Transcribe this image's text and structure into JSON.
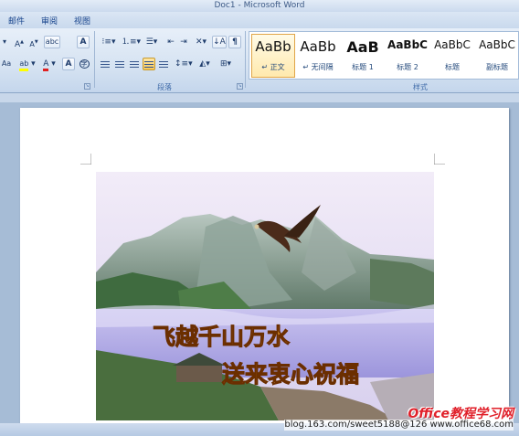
{
  "window": {
    "title": "Doc1 - Microsoft Word"
  },
  "tabs": [
    "邮件",
    "审阅",
    "视图"
  ],
  "ribbon": {
    "font_group": {
      "row1": [
        "A",
        "A",
        "abc",
        "A"
      ],
      "row2": [
        "Aa",
        "ab",
        "A",
        "A",
        "字"
      ]
    },
    "paragraph_group": {
      "label": "段落"
    },
    "styles_group": {
      "label": "样式",
      "items": [
        {
          "preview": "AaBb",
          "name": "正文",
          "active": true
        },
        {
          "preview": "AaBb",
          "name": "无间隔",
          "active": false
        },
        {
          "preview": "AaB",
          "name": "标题 1",
          "active": false
        },
        {
          "preview": "AaBbC",
          "name": "标题 2",
          "active": false
        },
        {
          "preview": "AaBbC",
          "name": "标题",
          "active": false
        },
        {
          "preview": "AaBbC",
          "name": "副标题",
          "active": false
        }
      ]
    },
    "style_marks": [
      "↵",
      "↵"
    ]
  },
  "document": {
    "picture_text": {
      "line1": "飞越千山万水",
      "line2": "送来衷心祝福"
    }
  },
  "watermark": {
    "line1": "Office教程学习网",
    "line2": "blog.163.com/sweet5188@126 www.office68.com"
  },
  "colors": {
    "ribbon_bg": "#d6e3f2",
    "accent": "#15428b",
    "highlight_yellow": "#ffff00",
    "font_color_red": "#e02020",
    "watermark_red": "#e0202a"
  },
  "icons": [
    "grow-font-icon",
    "shrink-font-icon",
    "clear-format-icon",
    "bullets-icon",
    "numbering-icon",
    "multilevel-list-icon",
    "decrease-indent-icon",
    "increase-indent-icon",
    "chinese-layout-icon",
    "sort-icon",
    "show-marks-icon",
    "align-left-icon",
    "center-icon",
    "align-right-icon",
    "justify-icon",
    "distributed-icon",
    "line-spacing-icon",
    "shading-icon",
    "borders-icon",
    "dialog-launcher-icon",
    "eagle-image"
  ]
}
